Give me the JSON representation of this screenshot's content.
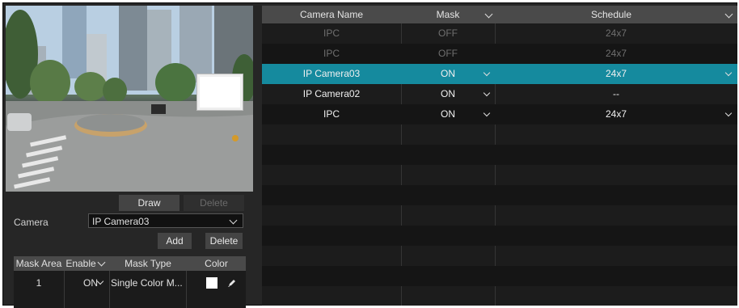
{
  "left": {
    "draw_label": "Draw",
    "delete_top_label": "Delete",
    "camera_label": "Camera",
    "camera_value": "IP Camera03",
    "add_label": "Add",
    "delete_label": "Delete",
    "mask_table": {
      "headers": [
        "Mask Area",
        "Enable",
        "Mask Type",
        "Color"
      ],
      "rows": [
        {
          "area": "1",
          "enable": "ON",
          "type": "Single Color M...",
          "color": "#ffffff"
        }
      ]
    }
  },
  "right": {
    "headers": {
      "camera_name": "Camera Name",
      "mask": "Mask",
      "schedule": "Schedule"
    },
    "rows": [
      {
        "name": "IPC",
        "mask": "OFF",
        "schedule": "24x7",
        "state": "disabled"
      },
      {
        "name": "IPC",
        "mask": "OFF",
        "schedule": "24x7",
        "state": "disabled"
      },
      {
        "name": "IP Camera03",
        "mask": "ON",
        "schedule": "24x7",
        "state": "selected"
      },
      {
        "name": "IP Camera02",
        "mask": "ON",
        "schedule": "--",
        "state": "normal"
      },
      {
        "name": "IPC",
        "mask": "ON",
        "schedule": "24x7",
        "state": "normal"
      }
    ]
  },
  "colors": {
    "selected_row": "#158a9e",
    "panel_bg": "#262626"
  }
}
